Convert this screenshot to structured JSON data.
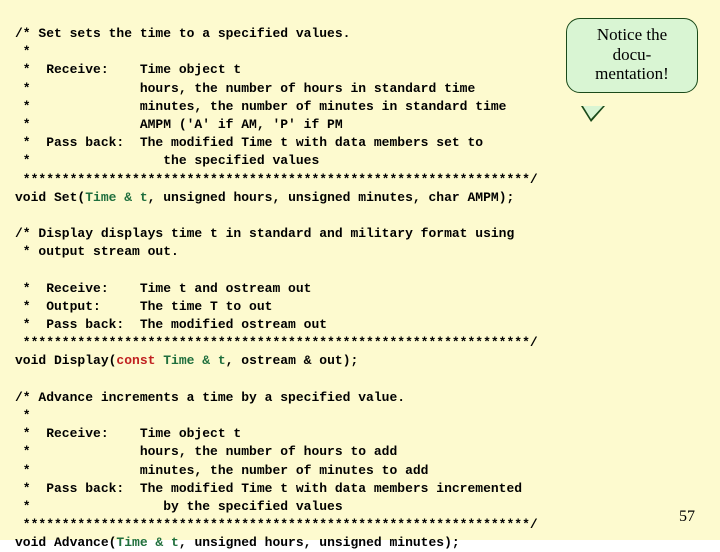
{
  "callout": {
    "line1": "Notice the",
    "line2": "docu-",
    "line3": "mentation!"
  },
  "code": {
    "c1_l1": "/* Set sets the time to a specified values.",
    "c1_l2": " *",
    "c1_l3": " *  Receive:    Time object t",
    "c1_l4": " *              hours, the number of hours in standard time",
    "c1_l5": " *              minutes, the number of minutes in standard time",
    "c1_l6": " *              AMPM ('A' if AM, 'P' if PM",
    "c1_l7": " *  Pass back:  The modified Time t with data members set to",
    "c1_l8": " *                 the specified values",
    "c1_l9": " *****************************************************************/",
    "sig1_a": "void Set(",
    "sig1_t": "Time & t",
    "sig1_b": ", unsigned hours, unsigned minutes, char AMPM);",
    "c2_l1": "/* Display displays time t in standard and military format using",
    "c2_l2": " * output stream out.",
    "c2_l3_blank": "",
    "c2_l4": " *  Receive:    Time t and ostream out",
    "c2_l5": " *  Output:     The time T to out",
    "c2_l6": " *  Pass back:  The modified ostream out",
    "c2_l7": " *****************************************************************/",
    "sig2_a": "void Display(",
    "sig2_k": "const",
    "sig2_sp": " ",
    "sig2_t": "Time & t",
    "sig2_b": ", ostream & out);",
    "c3_l1": "/* Advance increments a time by a specified value.",
    "c3_l2": " *",
    "c3_l3": " *  Receive:    Time object t",
    "c3_l4": " *              hours, the number of hours to add",
    "c3_l5": " *              minutes, the number of minutes to add",
    "c3_l6": " *  Pass back:  The modified Time t with data members incremented",
    "c3_l7": " *                 by the specified values",
    "c3_l8": " *****************************************************************/",
    "sig3_a": "void Advance(",
    "sig3_t": "Time & t",
    "sig3_b": ", unsigned hours, unsigned minutes);"
  },
  "page_number": "57"
}
